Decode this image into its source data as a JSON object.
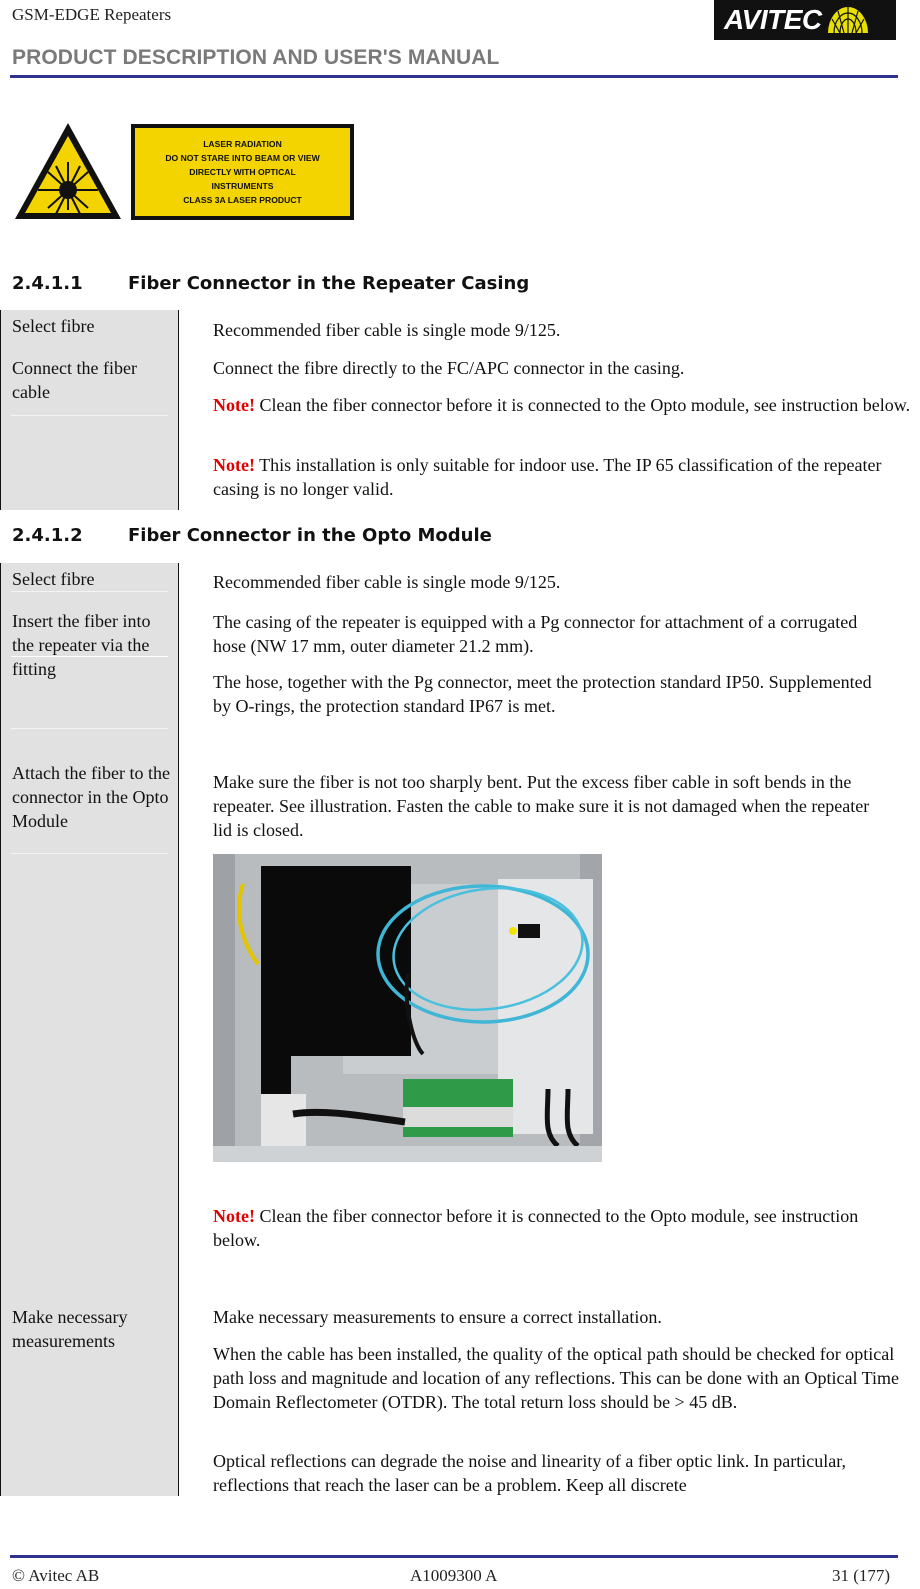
{
  "header": {
    "title": "GSM-EDGE Repeaters",
    "subtitle": "PRODUCT DESCRIPTION AND USER'S MANUAL",
    "logo_text": "AVITEC",
    "rule_color": "#2e3192"
  },
  "laser_warning": {
    "icon": "laser-hazard-icon",
    "label_lines": [
      "LASER RADIATION",
      "DO NOT STARE INTO BEAM OR VIEW",
      "DIRECTLY WITH OPTICAL",
      "INSTRUMENTS",
      "CLASS 3A LASER PRODUCT"
    ],
    "color": "#f4d400"
  },
  "sections": [
    {
      "number": "2.4.1.1",
      "title": "Fiber Connector in the Repeater Casing",
      "rows": [
        {
          "label": "Select fibre",
          "paragraphs": [
            {
              "text": "Recommended fiber cable is single mode 9/125."
            }
          ]
        },
        {
          "label": "Connect the fiber cable",
          "paragraphs": [
            {
              "text": "Connect the fibre directly to the FC/APC connector in the casing."
            },
            {
              "note": "Note!",
              "text": " Clean the fiber connector before it is connected to the Opto module, see instruction below."
            },
            {
              "note": "Note!",
              "text": " This installation is only suitable for indoor use. The IP 65 classification of the repeater casing is no longer valid."
            }
          ]
        }
      ]
    },
    {
      "number": "2.4.1.2",
      "title": "Fiber Connector in the Opto Module",
      "rows": [
        {
          "label": "Select fibre",
          "paragraphs": [
            {
              "text": "Recommended fiber cable is single mode 9/125."
            }
          ]
        },
        {
          "label": "Insert the fiber into the repeater via the fitting",
          "paragraphs": [
            {
              "text": "The casing of the repeater is equipped with a Pg connector for attachment of a corrugated hose (NW 17 mm, outer diameter 21.2 mm)."
            },
            {
              "text": "The hose, together with the Pg connector, meet the protection standard IP50. Supplemented by O-rings, the protection standard IP67 is met."
            }
          ]
        },
        {
          "label": "Attach the fiber to the connector in the Opto Module",
          "paragraphs": [
            {
              "text": "Make sure the fiber is not too sharply bent. Put the excess fiber cable in soft bends in the repeater. See illustration. Fasten the cable to make sure it is not damaged when the repeater lid is closed."
            },
            {
              "note": "Note!",
              "text": " Clean the fiber connector before it is connected to the Opto module, see instruction below."
            }
          ],
          "image": "repeater-interior-photo"
        },
        {
          "label": "Make necessary measurements",
          "paragraphs": [
            {
              "text": "Make necessary measurements to ensure a correct installation."
            },
            {
              "text": "When the cable has been installed, the quality of the optical path should be checked for optical path loss and magnitude and location of any reflections. This can be done with an Optical Time Domain Reflectometer (OTDR). The total return loss should be > 45 dB."
            },
            {
              "text": " Optical reflections can degrade the noise and linearity of a fiber optic link. In particular, reflections that reach the laser can be a problem. Keep all discrete"
            }
          ]
        }
      ]
    }
  ],
  "footer": {
    "left": "© Avitec AB",
    "center": "A1009300 A",
    "right": "31 (177)"
  },
  "colors": {
    "note": "#e00000",
    "label_column": "#e1e1e1"
  }
}
